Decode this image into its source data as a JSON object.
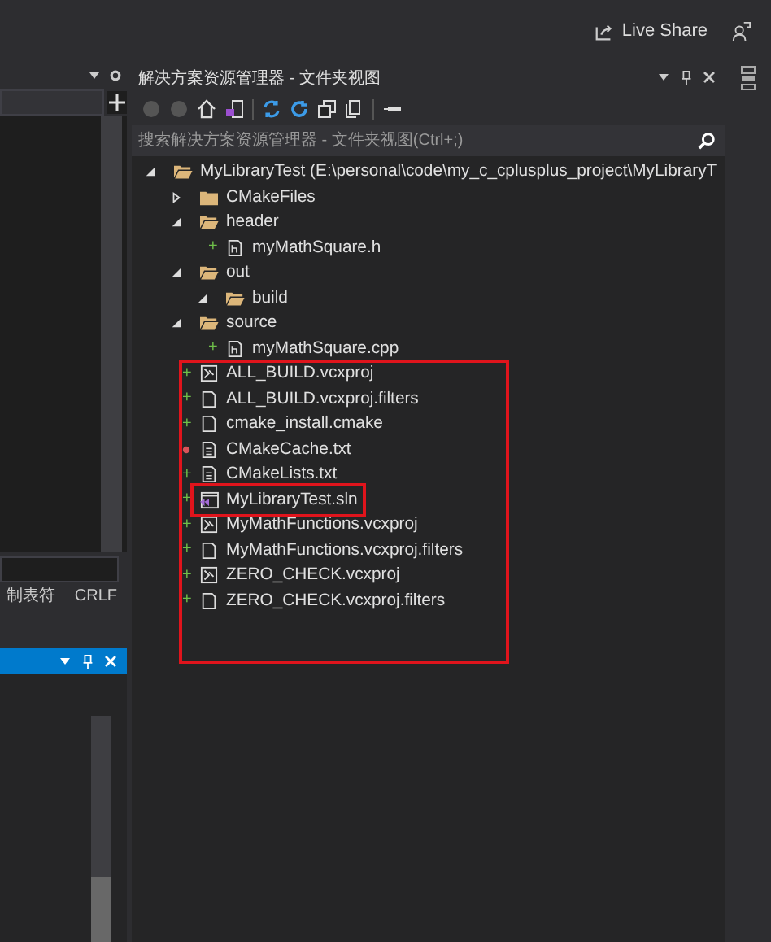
{
  "top_bar": {
    "live_share": "Live Share"
  },
  "left_panel": {
    "status_bar": [
      "制表符",
      "CRLF"
    ]
  },
  "explorer": {
    "title": "解决方案资源管理器 - 文件夹视图",
    "search": {
      "placeholder": "搜索解决方案资源管理器 - 文件夹视图(Ctrl+;)"
    },
    "tree": [
      {
        "label": "MyLibraryTest (E:\\personal\\code\\my_c_cplusplus_project\\MyLibraryT",
        "kind": "folder",
        "expanded": true,
        "children": [
          {
            "label": "CMakeFiles",
            "kind": "folder",
            "expanded": false
          },
          {
            "label": "header",
            "kind": "folder",
            "expanded": true,
            "children": [
              {
                "label": "myMathSquare.h",
                "kind": "code",
                "marker": "+",
                "ignored": false
              }
            ]
          },
          {
            "label": "out",
            "kind": "folder",
            "expanded": true,
            "children": [
              {
                "label": "build",
                "kind": "folder",
                "expanded": true
              }
            ]
          },
          {
            "label": "source",
            "kind": "folder",
            "expanded": true,
            "children": [
              {
                "label": "myMathSquare.cpp",
                "kind": "code",
                "marker": "+",
                "ignored": false
              }
            ]
          },
          {
            "label": "ALL_BUILD.vcxproj",
            "kind": "project",
            "marker": "+",
            "ignored": false
          },
          {
            "label": "ALL_BUILD.vcxproj.filters",
            "kind": "file",
            "marker": "+",
            "ignored": false
          },
          {
            "label": "cmake_install.cmake",
            "kind": "file",
            "marker": "+",
            "ignored": false
          },
          {
            "label": "CMakeCache.txt",
            "kind": "text",
            "ignored": true
          },
          {
            "label": "CMakeLists.txt",
            "kind": "text",
            "marker": "+",
            "ignored": false
          },
          {
            "label": "MyLibraryTest.sln",
            "kind": "solution",
            "marker": "+",
            "ignored": false
          },
          {
            "label": "MyMathFunctions.vcxproj",
            "kind": "project",
            "marker": "+",
            "ignored": false
          },
          {
            "label": "MyMathFunctions.vcxproj.filters",
            "kind": "file",
            "marker": "+",
            "ignored": false
          },
          {
            "label": "ZERO_CHECK.vcxproj",
            "kind": "project",
            "marker": "+",
            "ignored": false
          },
          {
            "label": "ZERO_CHECK.vcxproj.filters",
            "kind": "file",
            "marker": "+",
            "ignored": false
          }
        ]
      }
    ]
  }
}
